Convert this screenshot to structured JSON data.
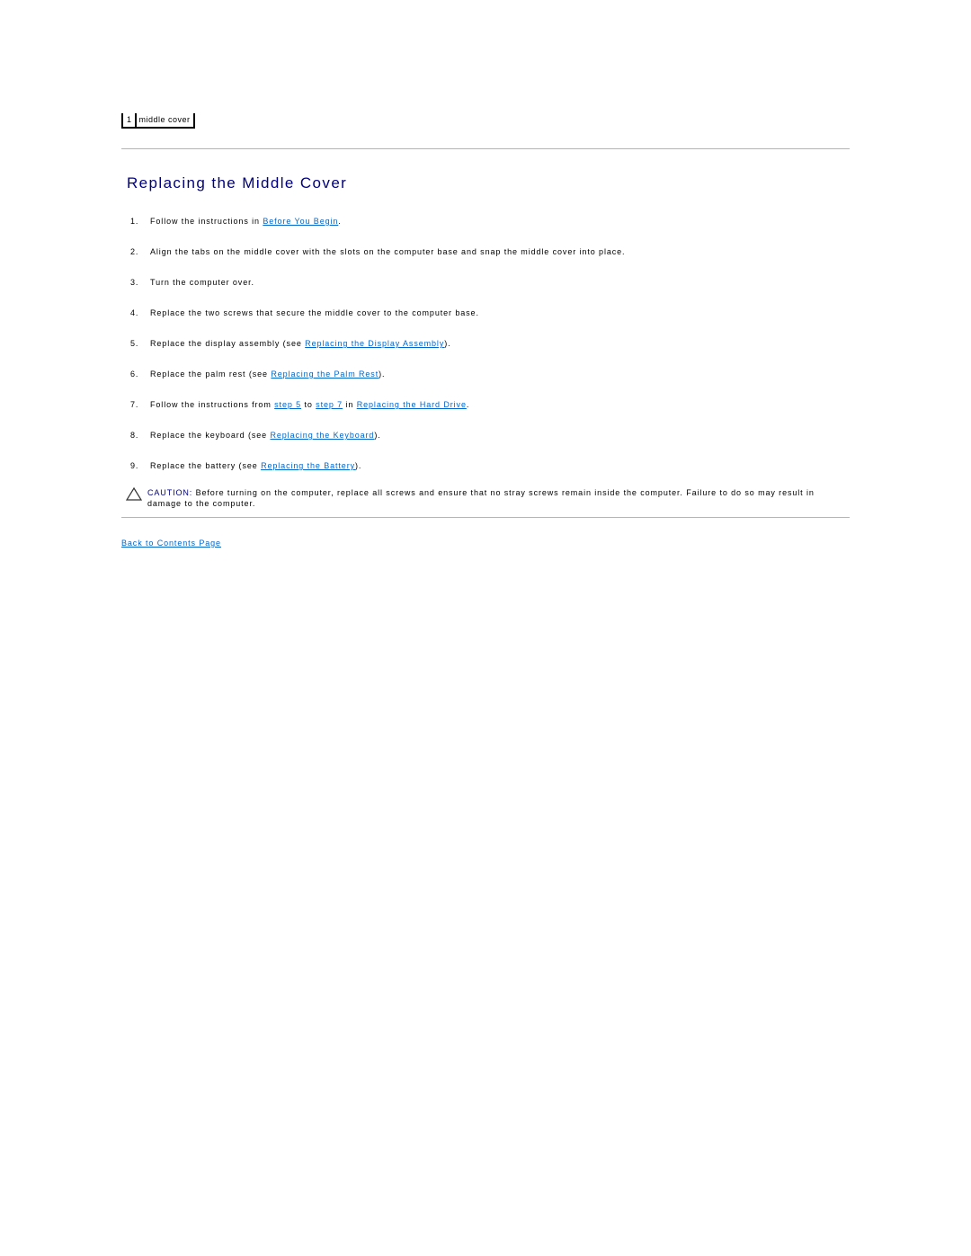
{
  "callout": {
    "number": "1",
    "label": "middle cover"
  },
  "section": {
    "title": "Replacing the Middle Cover"
  },
  "steps": [
    {
      "num": "1.",
      "pre": "Follow the instructions in ",
      "link": "Before You Begin",
      "post": "."
    },
    {
      "num": "2.",
      "text": "Align the tabs on the middle cover with the slots on the computer base and snap the middle cover into place."
    },
    {
      "num": "3.",
      "text": "Turn the computer over."
    },
    {
      "num": "4.",
      "text": "Replace the two screws that secure the middle cover to the computer base."
    },
    {
      "num": "5.",
      "pre": "Replace the display assembly (see ",
      "link": "Replacing the Display Assembly",
      "post": ")."
    },
    {
      "num": "6.",
      "pre": "Replace the palm rest (see ",
      "link": "Replacing the Palm Rest",
      "post": ")."
    },
    {
      "num": "7.",
      "pre": "Follow the instructions from ",
      "link1": "step 5",
      "mid1": " to ",
      "link2": "step 7",
      "mid2": " in ",
      "link3": "Replacing the Hard Drive",
      "post": "."
    },
    {
      "num": "8.",
      "pre": "Replace the keyboard (see ",
      "link": "Replacing the Keyboard",
      "post": ")."
    },
    {
      "num": "9.",
      "pre": "Replace the battery (see ",
      "link": "Replacing the Battery",
      "post": ")."
    }
  ],
  "caution": {
    "icon": "caution-triangle-icon",
    "label": "CAUTION:",
    "text": " Before turning on the computer, replace all screws and ensure that no stray screws remain inside the computer. Failure to do so may result in damage to the computer."
  },
  "footer": {
    "back_link": "Back to Contents Page"
  },
  "colors": {
    "title": "#000080",
    "link": "#0066cc",
    "rule": "#b4b4b4"
  }
}
